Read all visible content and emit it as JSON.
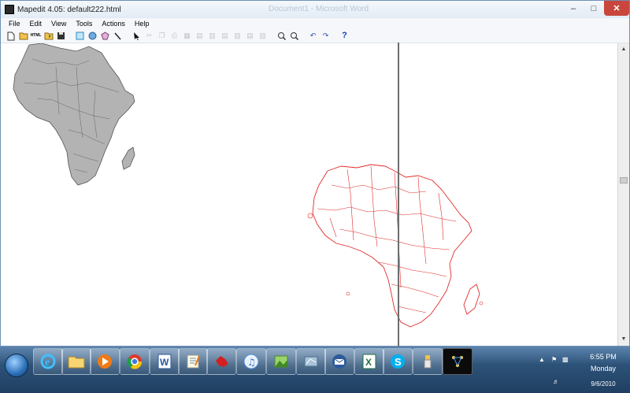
{
  "window": {
    "title": "Mapedit 4.05: default222.html",
    "ghost_title": "Document1 - Microsoft Word"
  },
  "menu": [
    "File",
    "Edit",
    "View",
    "Tools",
    "Actions",
    "Help"
  ],
  "toolbar": {
    "icons": [
      "new-file-icon",
      "open-file-icon",
      "html-icon",
      "open-folder-icon",
      "save-icon",
      "rectangle-tool-icon",
      "circle-tool-icon",
      "polygon-tool-icon",
      "line-tool-icon",
      "pointer-icon",
      "cut-icon",
      "copy-icon",
      "paste-icon",
      "group-icon",
      "zoom-in-icon",
      "zoom-out-icon",
      "undo-icon",
      "redo-icon",
      "help-icon"
    ],
    "html_label": "HTML",
    "help_label": "?"
  },
  "map": {
    "filled_color": "#b3b3b3",
    "outline_color": "#e02a2a"
  },
  "taskbar": {
    "apps": [
      "internet-explorer-icon",
      "file-explorer-icon",
      "media-player-icon",
      "chrome-icon",
      "word-icon",
      "notepad-icon",
      "paint-icon",
      "itunes-icon",
      "photo-gallery-icon",
      "mapedit-icon",
      "outlook-icon",
      "excel-icon",
      "skype-icon",
      "usb-icon",
      "network-app-icon"
    ],
    "clock_time": "6:55 PM",
    "clock_day": "Monday",
    "clock_date": "9/6/2010"
  }
}
